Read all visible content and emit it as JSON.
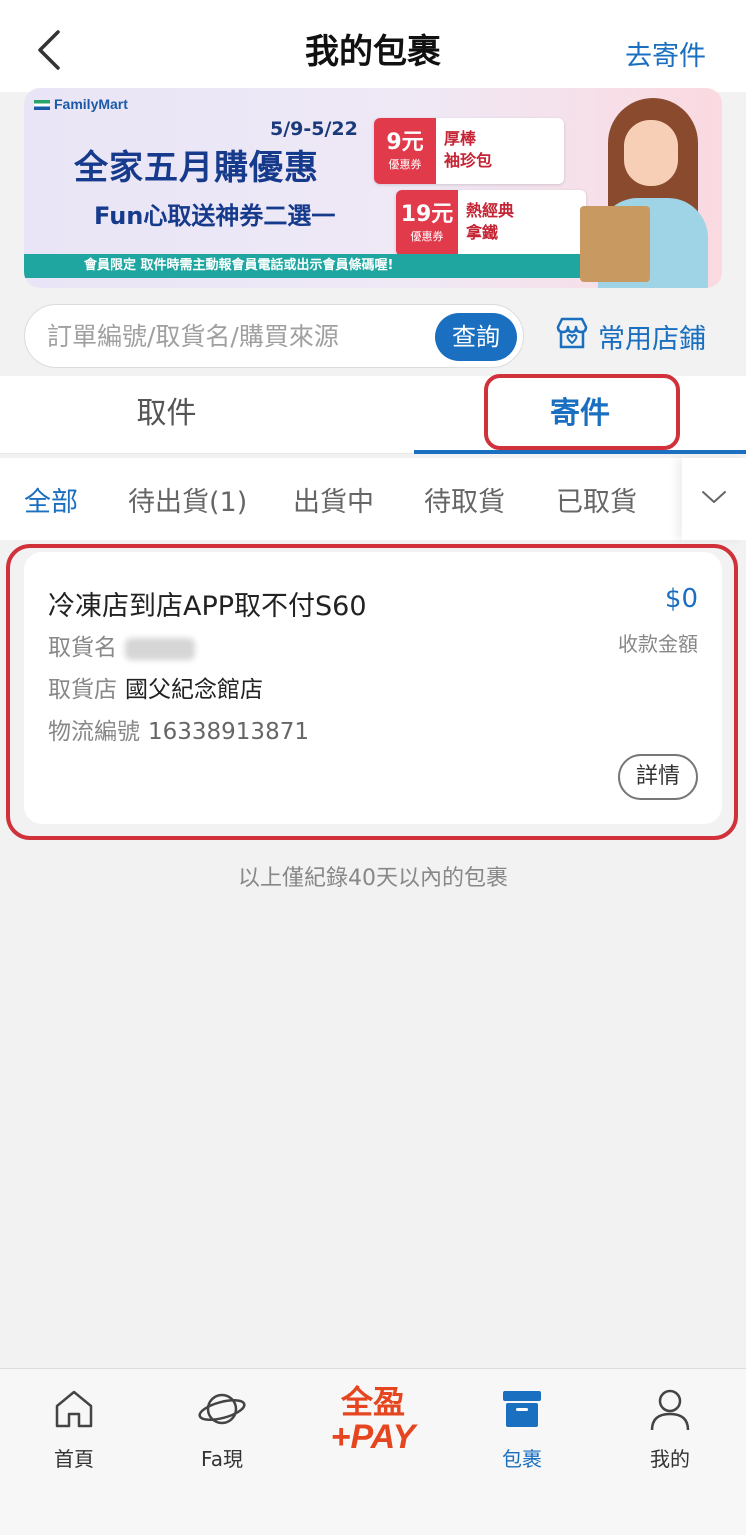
{
  "header": {
    "title": "我的包裹",
    "go_send": "去寄件"
  },
  "banner": {
    "brand": "FamilyMart",
    "dates": "5/9-5/22",
    "headline": "全家五月購優惠",
    "subline": "Fun心取送神券二選一",
    "strip": "會員限定 取件時需主動報會員電話或出示會員條碼喔!",
    "coupons": [
      {
        "amount": "9元",
        "tag": "優惠券",
        "item_line1": "厚棒",
        "item_line2": "袖珍包"
      },
      {
        "amount": "19元",
        "tag": "優惠券",
        "item_line1": "熱經典",
        "item_line2": "拿鐵"
      }
    ]
  },
  "search": {
    "placeholder": "訂單編號/取貨名/購買來源",
    "button": "查詢",
    "fav_store": "常用店鋪"
  },
  "tabs": {
    "pickup": "取件",
    "send": "寄件"
  },
  "filters": [
    "全部",
    "待出貨(1)",
    "出貨中",
    "待取貨",
    "已取貨"
  ],
  "package": {
    "name": "冷凍店到店APP取不付S60",
    "amount": "$0",
    "amount_label": "收款金額",
    "recipient_label": "取貨名",
    "store_label": "取貨店",
    "store_value": "國父紀念館店",
    "tracking_label": "物流編號",
    "tracking_value": "16338913871",
    "detail_button": "詳情"
  },
  "footer_note": "以上僅紀錄40天以內的包裹",
  "bottom_nav": {
    "home": "首頁",
    "fa": "Fa現",
    "pay_line1": "全盈",
    "pay_line2": "+PAY",
    "parcel": "包裹",
    "me": "我的"
  },
  "colors": {
    "primary": "#1a6fc0",
    "highlight": "#d0313a",
    "pay": "#e5451f"
  }
}
